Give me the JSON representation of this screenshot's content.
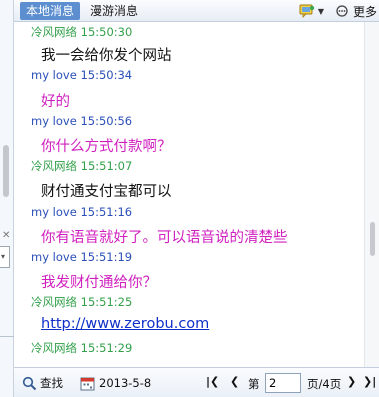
{
  "tabs": [
    {
      "label": "本地消息",
      "active": true
    },
    {
      "label": "漫游消息",
      "active": false
    }
  ],
  "toolbar": {
    "more_label": "更多",
    "icons": [
      "chat-bubble-icon",
      "dropdown-caret-icon",
      "more-icon"
    ]
  },
  "messages": [
    {
      "sender": "冷风网络",
      "time": "15:50:30",
      "text": "我一会给你发个网站"
    },
    {
      "sender": "my love",
      "time": "15:50:34",
      "text": "好的"
    },
    {
      "sender": "my love",
      "time": "15:50:56",
      "text": "你什么方式付款啊？"
    },
    {
      "sender": "冷风网络",
      "time": "15:51:07",
      "text": "财付通支付宝都可以"
    },
    {
      "sender": "my love",
      "time": "15:51:16",
      "text": "你有语音就好了。可以语音说的清楚些"
    },
    {
      "sender": "my love",
      "time": "15:51:19",
      "text": "我发财付通给你？"
    },
    {
      "sender": "冷风网络",
      "time": "15:51:25",
      "text": "http://www.zerobu.com"
    },
    {
      "sender": "冷风网络",
      "time": "15:51:29",
      "text": ""
    }
  ],
  "footer": {
    "search_label": "查找",
    "date": "2013-5-8",
    "page_prefix": "第",
    "page_value": "2",
    "page_suffix": "页/4页"
  },
  "colors": {
    "self_name": "#32a04a",
    "other_name": "#2a4fb8",
    "other_text": "#d01fbf",
    "link": "#0f2fc8",
    "active_tab": "#5c8ed0"
  }
}
